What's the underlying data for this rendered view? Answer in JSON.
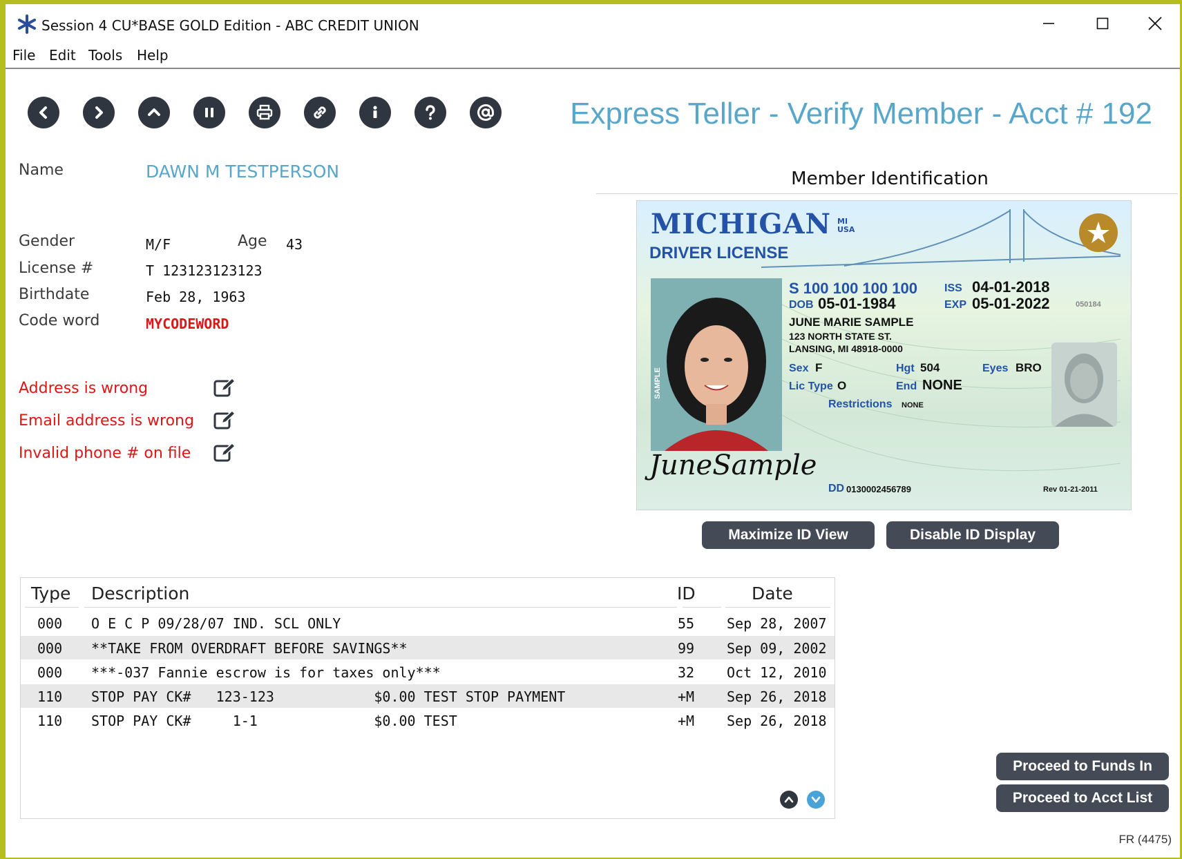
{
  "window": {
    "title": "Session 4 CU*BASE GOLD Edition - ABC CREDIT UNION",
    "controls": [
      "minimize-icon",
      "maximize-icon",
      "close-icon"
    ]
  },
  "menu": [
    "File",
    "Edit",
    "Tools",
    "Help"
  ],
  "toolbar": {
    "buttons": [
      "back-icon",
      "forward-icon",
      "up-icon",
      "pause-icon",
      "print-icon",
      "link-icon",
      "info-icon",
      "help-icon",
      "email-icon"
    ]
  },
  "page_title": "Express Teller - Verify Member - Acct # 192",
  "member": {
    "name_label": "Name",
    "name": "DAWN M TESTPERSON",
    "gender_label": "Gender",
    "gender": "M/F",
    "age_label": "Age",
    "age": "43",
    "license_label": "License #",
    "license": "T 123123123123",
    "birthdate_label": "Birthdate",
    "birthdate": "Feb 28, 1963",
    "codeword_label": "Code word",
    "codeword": "MYCODEWORD"
  },
  "warnings": [
    {
      "text": "Address is wrong"
    },
    {
      "text": "Email address is wrong"
    },
    {
      "text": "Invalid phone # on file"
    }
  ],
  "id_section": {
    "title": "Member Identification",
    "card": {
      "state": "MICHIGAN",
      "state_abbr": "MI",
      "country": "USA",
      "type": "DRIVER LICENSE",
      "number": "S 100 100 100 100",
      "iss_label": "ISS",
      "iss": "04-01-2018",
      "dob_label": "DOB",
      "dob": "05-01-1984",
      "exp_label": "EXP",
      "exp": "05-01-2022",
      "code": "050184",
      "holder": "JUNE MARIE SAMPLE",
      "address1": "123 NORTH STATE ST.",
      "address2": "LANSING, MI 48918-0000",
      "sex_label": "Sex",
      "sex": "F",
      "hgt_label": "Hgt",
      "hgt": "504",
      "eyes_label": "Eyes",
      "eyes": "BRO",
      "lic_type_label": "Lic Type",
      "lic_type": "O",
      "end_label": "End",
      "end": "NONE",
      "restrictions_label": "Restrictions",
      "restrictions": "NONE",
      "dd_label": "DD",
      "dd": "0130002456789",
      "rev": "Rev 01-21-2011",
      "sample_mark": "SAMPLE",
      "signature": "JuneSample"
    },
    "maximize_label": "Maximize ID View",
    "disable_label": "Disable ID Display"
  },
  "grid": {
    "headers": {
      "type": "Type",
      "description": "Description",
      "id": "ID",
      "date": "Date"
    },
    "rows": [
      {
        "type": "000",
        "description": "O E C P 09/28/07 IND. SCL ONLY",
        "id": "55",
        "date": "Sep 28, 2007"
      },
      {
        "type": "000",
        "description": "**TAKE FROM OVERDRAFT BEFORE SAVINGS**",
        "id": "99",
        "date": "Sep 09, 2002"
      },
      {
        "type": "000",
        "description": "***-037 Fannie escrow is for taxes only***",
        "id": "32",
        "date": "Oct 12, 2010"
      },
      {
        "type": "110",
        "description": "STOP PAY CK#   123-123            $0.00 TEST STOP PAYMENT",
        "id": "+M",
        "date": "Sep 26, 2018"
      },
      {
        "type": "110",
        "description": "STOP PAY CK#     1-1              $0.00 TEST",
        "id": "+M",
        "date": "Sep 26, 2018"
      }
    ]
  },
  "actions": {
    "funds_in": "Proceed to Funds In",
    "acct_list": "Proceed to Acct List"
  },
  "footer_code": "FR (4475)",
  "colors": {
    "accent": "#58a6c9",
    "warning": "#e01616",
    "button": "#444b56",
    "frame": "#b5bd1f"
  }
}
